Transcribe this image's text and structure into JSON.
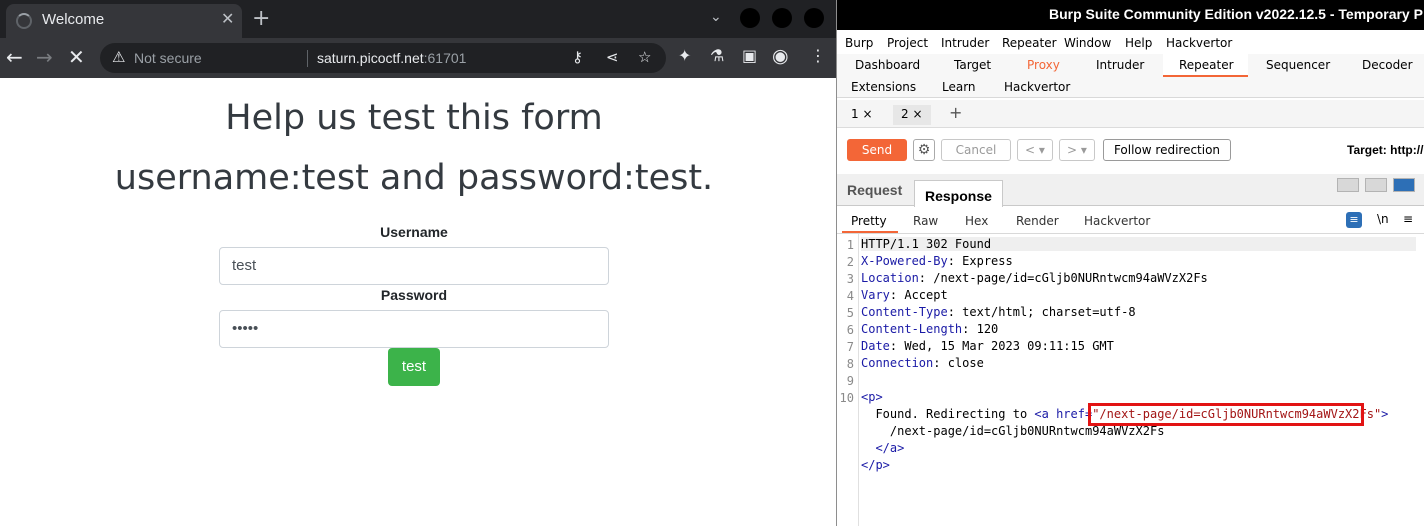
{
  "browser": {
    "tab_title": "Welcome",
    "omnibox": {
      "security": "Not secure",
      "host": "saturn.picoctf.net",
      "port": ":61701"
    },
    "page": {
      "heading_line1": "Help us test this form",
      "heading_line2": "username:test and password:test.",
      "username_label": "Username",
      "username_value": "test",
      "password_label": "Password",
      "password_value": "•••••",
      "submit_label": "test"
    }
  },
  "burp": {
    "title": "Burp Suite Community Edition v2022.12.5 - Temporary P",
    "menu": [
      "Burp",
      "Project",
      "Intruder",
      "Repeater",
      "Window",
      "Help",
      "Hackvertor"
    ],
    "tools_row1": [
      "Dashboard",
      "Target",
      "Proxy",
      "Intruder",
      "Repeater",
      "Sequencer",
      "Decoder"
    ],
    "tools_row2": [
      "Extensions",
      "Learn",
      "Hackvertor"
    ],
    "repeater_tabs": [
      "1",
      "2"
    ],
    "controls": {
      "send": "Send",
      "cancel": "Cancel",
      "follow": "Follow redirection",
      "target": "Target: http://"
    },
    "rr_tabs": [
      "Request",
      "Response"
    ],
    "format_tabs": [
      "Pretty",
      "Raw",
      "Hex",
      "Render",
      "Hackvertor"
    ],
    "format_icons": [
      "\\n",
      "≡"
    ],
    "response_lines": [
      {
        "n": "1",
        "k": "",
        "v": "HTTP/1.1 302 Found"
      },
      {
        "n": "2",
        "k": "X-Powered-By",
        "v": ": Express"
      },
      {
        "n": "3",
        "k": "Location",
        "v": ": /next-page/id=cGljb0NURntwcm94aWVzX2Fs"
      },
      {
        "n": "4",
        "k": "Vary",
        "v": ": Accept"
      },
      {
        "n": "5",
        "k": "Content-Type",
        "v": ": text/html; charset=utf-8"
      },
      {
        "n": "6",
        "k": "Content-Length",
        "v": ": 120"
      },
      {
        "n": "7",
        "k": "Date",
        "v": ": Wed, 15 Mar 2023 09:11:15 GMT"
      },
      {
        "n": "8",
        "k": "Connection",
        "v": ": close"
      },
      {
        "n": "9",
        "k": "",
        "v": ""
      },
      {
        "n": "10",
        "k": "",
        "v": ""
      }
    ],
    "body": {
      "p_open": "<p>",
      "found_text": "  Found. Redirecting to ",
      "a_open": "<a href=",
      "href_value": "\"/next-page/id=cGljb0NURntwcm94aWVzX2Fs\"",
      "a_close_bracket": ">",
      "link_text": "    /next-page/id=cGljb0NURntwcm94aWVzX2Fs",
      "a_close": "  </a>",
      "p_close": "</p>"
    }
  }
}
